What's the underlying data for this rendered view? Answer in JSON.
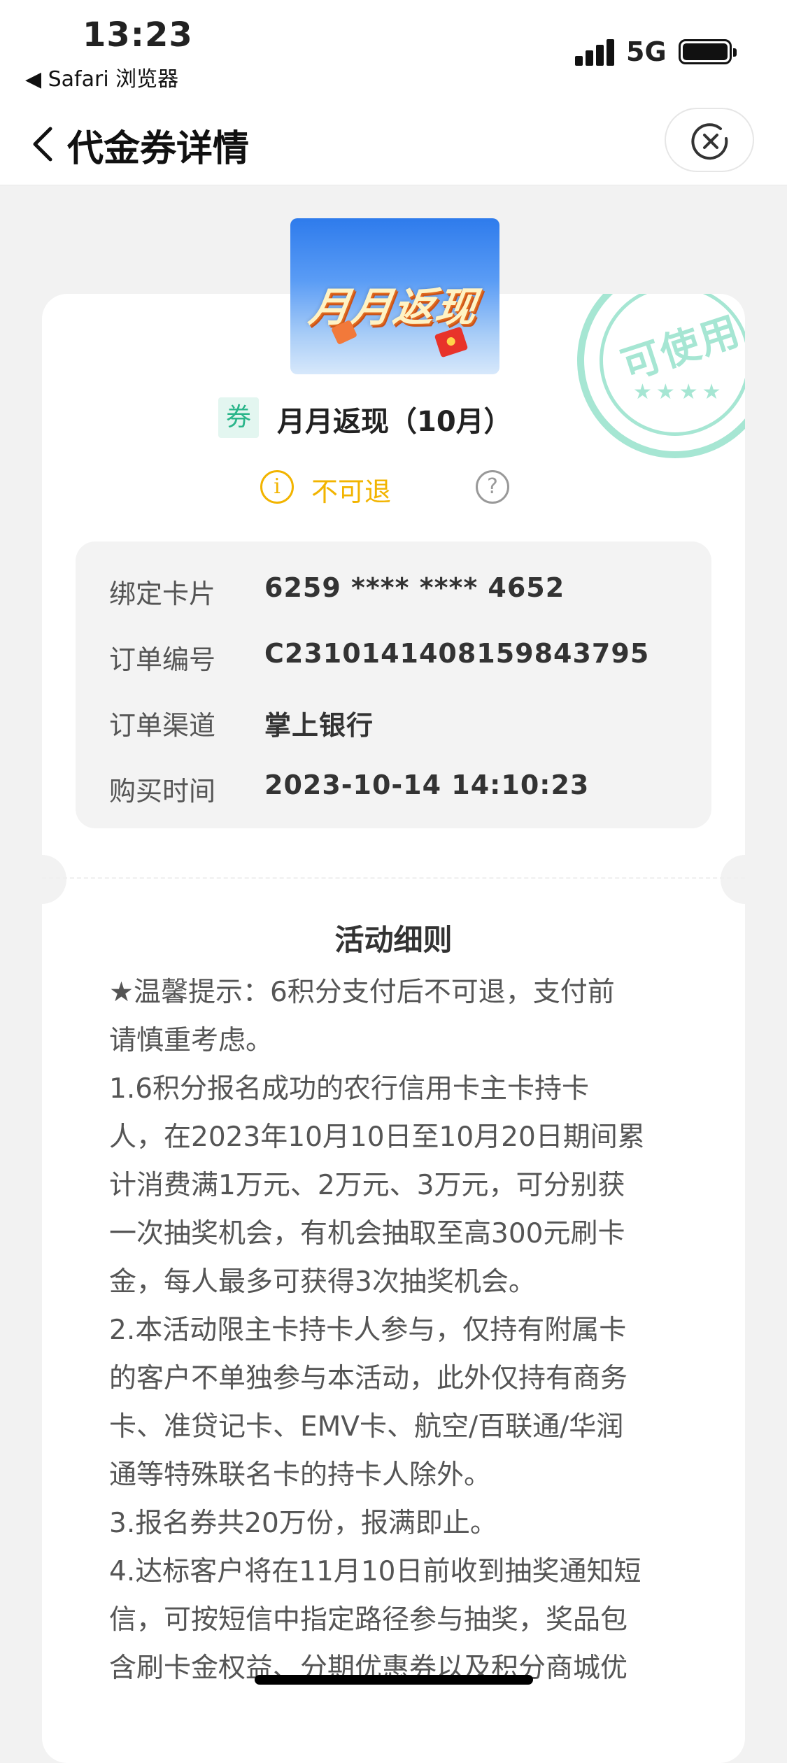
{
  "status_bar": {
    "time": "13:23",
    "back_app": "◀ Safari 浏览器",
    "network": "5G"
  },
  "nav": {
    "title": "代金券详情"
  },
  "banner": {
    "text": "月月返现"
  },
  "stamp": {
    "text": "可使用",
    "stars": "★★★★"
  },
  "coupon": {
    "tag": "券",
    "name": "月月返现（10月）",
    "refund_label": "不可退",
    "info_icon": "i",
    "help_icon": "?"
  },
  "details": [
    {
      "label": "绑定卡片",
      "value": "6259 **** **** 4652"
    },
    {
      "label": "订单编号",
      "value": "C2310141408159843795"
    },
    {
      "label": "订单渠道",
      "value": "掌上银行"
    },
    {
      "label": "购买时间",
      "value": "2023-10-14 14:10:23"
    }
  ],
  "rules": {
    "title": "活动细则",
    "lines": [
      "★温馨提示：6积分支付后不可退，支付前",
      "请慎重考虑。",
      "1.6积分报名成功的农行信用卡主卡持卡",
      "人，在2023年10月10日至10月20日期间累",
      "计消费满1万元、2万元、3万元，可分别获",
      "一次抽奖机会，有机会抽取至高300元刷卡",
      "金，每人最多可获得3次抽奖机会。",
      "2.本活动限主卡持卡人参与，仅持有附属卡",
      "的客户不单独参与本活动，此外仅持有商务",
      "卡、准贷记卡、EMV卡、航空/百联通/华润",
      "通等特殊联名卡的持卡人除外。",
      "3.报名券共20万份，报满即止。",
      "4.达标客户将在11月10日前收到抽奖通知短",
      "信，可按短信中指定路径参与抽奖，奖品包",
      "含刷卡金权益、分期优惠券以及积分商城优"
    ]
  },
  "colors": {
    "accent_yellow": "#f2b400",
    "coupon_green": "#2ab58a",
    "stamp_green": "#a6e6d3"
  },
  "icons": {
    "back": "chevron-left-icon",
    "close": "close-circle-icon"
  }
}
